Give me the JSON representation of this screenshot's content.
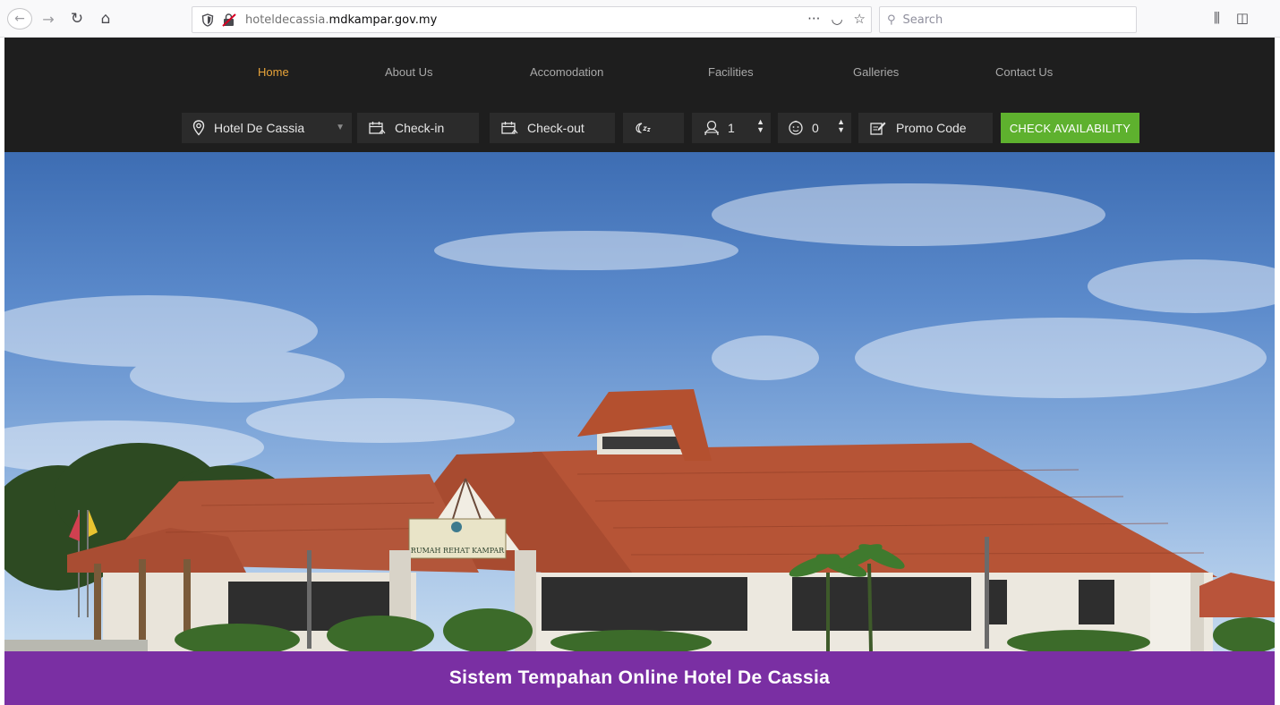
{
  "browser": {
    "url_prefix": "hoteldecassia.",
    "url_domain": "mdkampar.gov.my",
    "search_placeholder": "Search"
  },
  "nav": {
    "items": [
      {
        "label": "Home",
        "active": true
      },
      {
        "label": "About Us"
      },
      {
        "label": "Accomodation"
      },
      {
        "label": "Facilities"
      },
      {
        "label": "Galleries"
      },
      {
        "label": "Contact Us"
      }
    ]
  },
  "booking": {
    "hotel": "Hotel De Cassia",
    "checkin": "Check-in",
    "checkout": "Check-out",
    "adults": "1",
    "children": "0",
    "promo": "Promo Code",
    "check_button": "CHECK AVAILABILITY"
  },
  "hero": {
    "sign_text": "RUMAH REHAT KAMPAR"
  },
  "footer": {
    "title": "Sistem Tempahan Online Hotel De Cassia"
  },
  "colors": {
    "nav_active": "#e8a43a",
    "check_button": "#5eb12e",
    "footer_band": "#7a2fa3",
    "header_bg": "#1e1e1e"
  }
}
